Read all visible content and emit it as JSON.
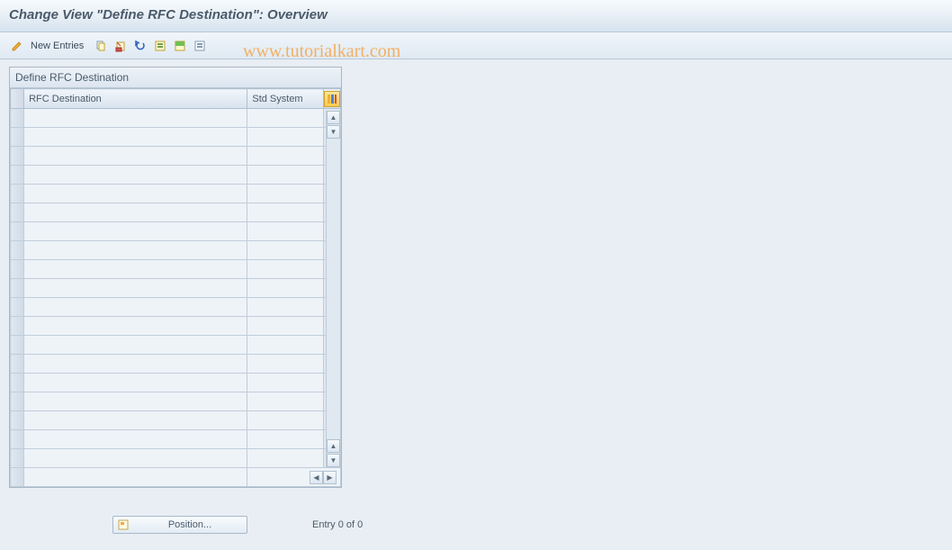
{
  "title": "Change View \"Define RFC Destination\": Overview",
  "toolbar": {
    "new_entries_label": "New Entries",
    "icons": [
      "pencil-icon",
      "copy-icon",
      "delete-icon",
      "undo-icon",
      "select-all-icon",
      "select-block-icon",
      "deselect-all-icon"
    ]
  },
  "panel": {
    "title": "Define RFC Destination",
    "columns": {
      "c1": "RFC Destination",
      "c2": "Std System"
    },
    "row_count": 19
  },
  "footer": {
    "position_label": "Position...",
    "entry_status": "Entry 0 of 0"
  },
  "watermark": "www.tutorialkart.com"
}
